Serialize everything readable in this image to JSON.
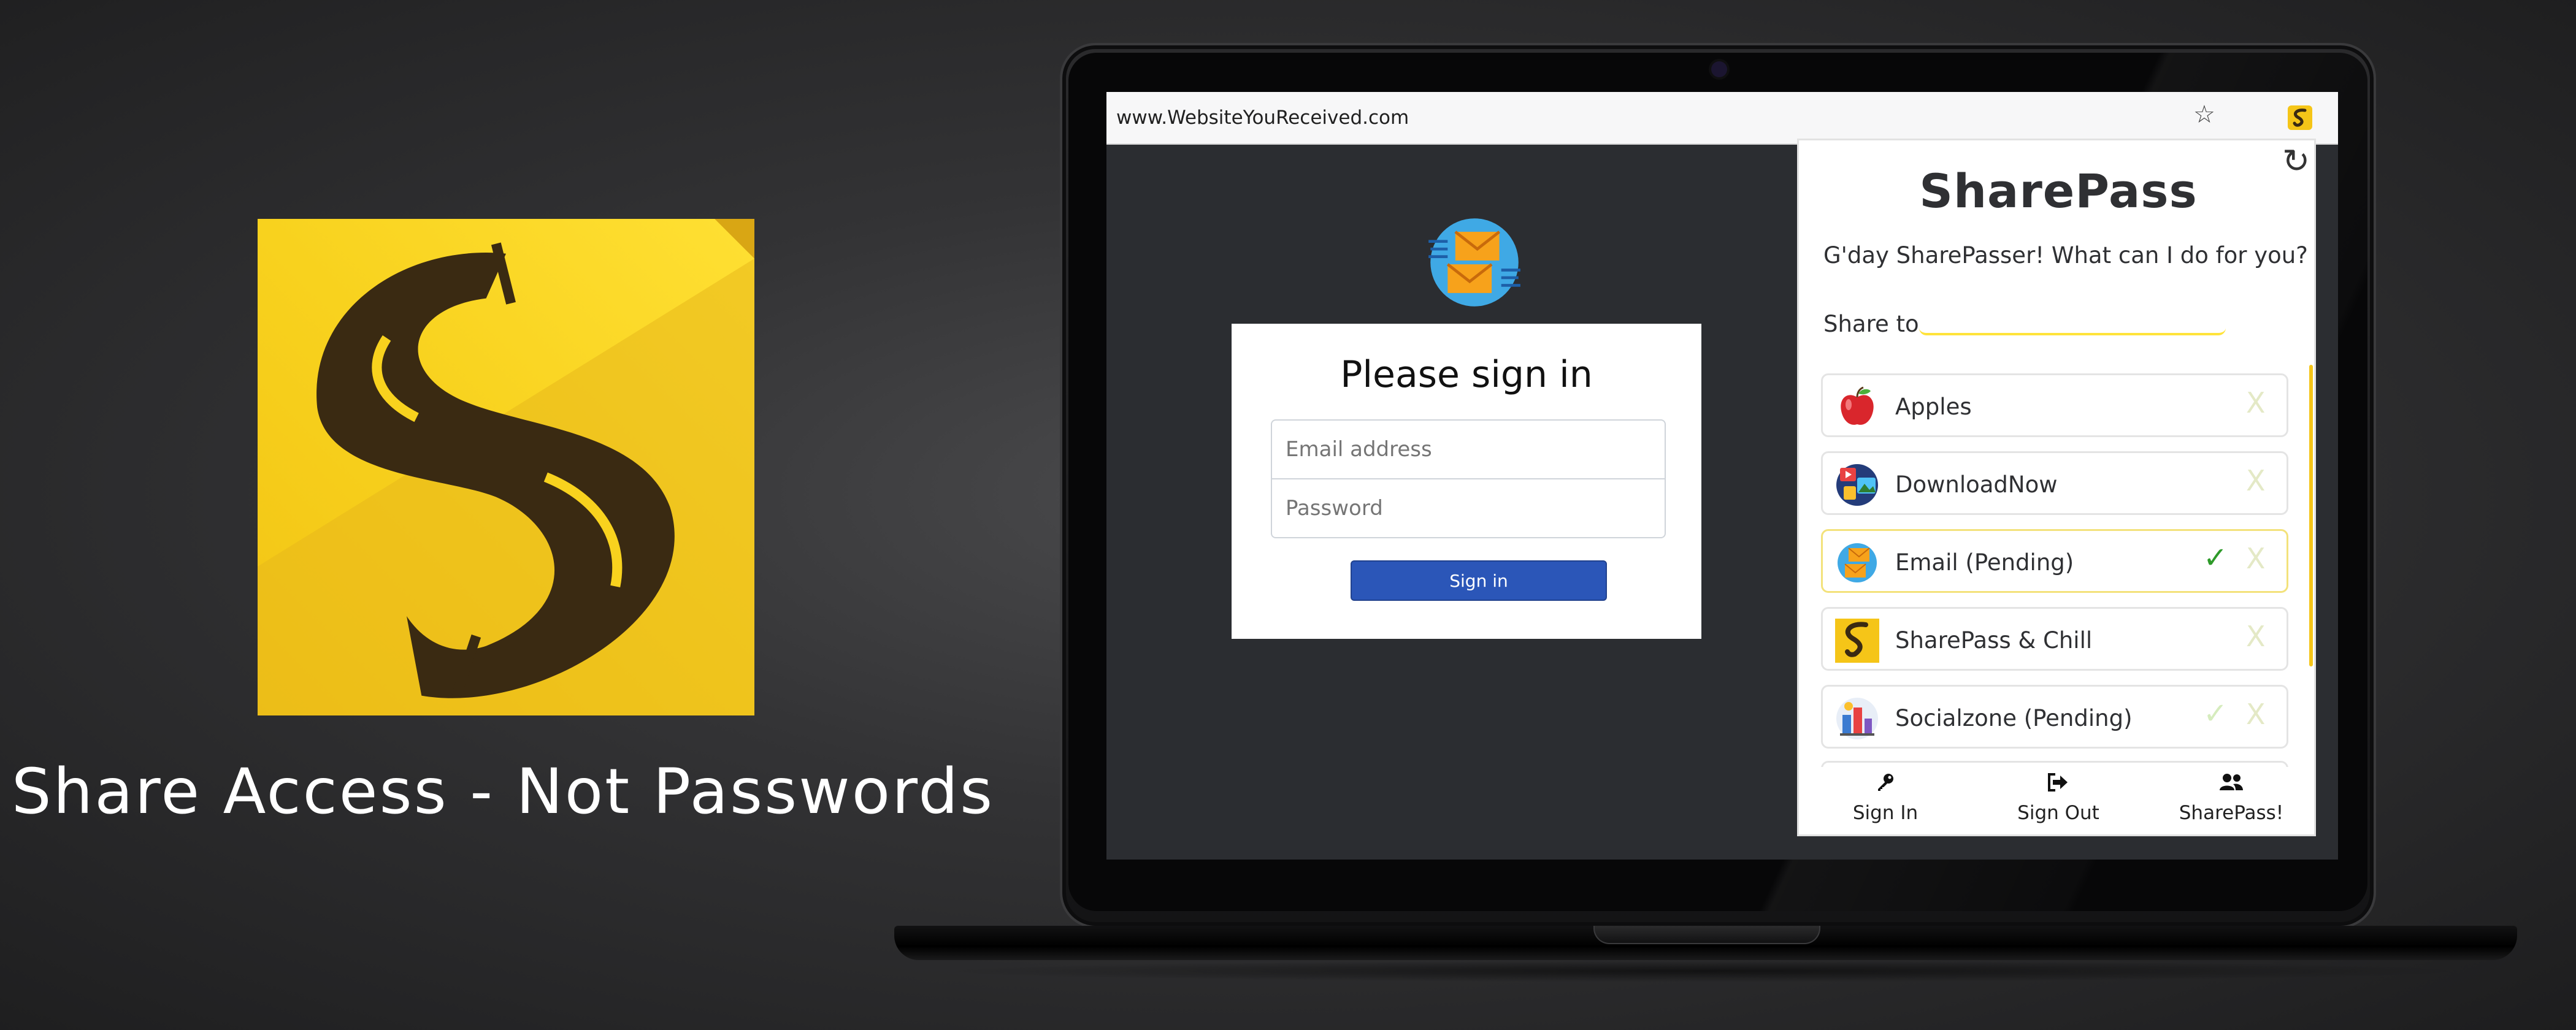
{
  "promo": {
    "tagline": "Share Access - Not Passwords",
    "logo_icon": "sharepass-s-logo"
  },
  "browser": {
    "url": "www.WebsiteYouReceived.com",
    "star_icon": "☆",
    "extension_icon": "sharepass-icon"
  },
  "signin_page": {
    "title": "Please sign in",
    "email_placeholder": "Email address",
    "password_placeholder": "Password",
    "button_label": "Sign in"
  },
  "popup": {
    "refresh_icon": "↻",
    "title": "SharePass",
    "greeting": "G'day SharePasser! What can I do for you?",
    "share_label": "Share to",
    "share_value": "",
    "items": [
      {
        "label": "Apples",
        "icon": "apple-icon",
        "close": "X",
        "check": "",
        "pending": false
      },
      {
        "label": "DownloadNow",
        "icon": "media-icon",
        "close": "X",
        "check": "",
        "pending": false
      },
      {
        "label": "Email (Pending)",
        "icon": "email-icon",
        "close": "X",
        "check": "✓",
        "pending": true
      },
      {
        "label": "SharePass & Chill",
        "icon": "sharepass-icon",
        "close": "X",
        "check": "",
        "pending": false
      },
      {
        "label": "Socialzone (Pending)",
        "icon": "social-icon",
        "close": "X",
        "check": "✓",
        "pending": false
      }
    ],
    "footer": [
      {
        "label": "Sign In",
        "icon": "key-icon"
      },
      {
        "label": "Sign Out",
        "icon": "sign-out-icon"
      },
      {
        "label": "SharePass!",
        "icon": "users-icon"
      }
    ]
  },
  "colors": {
    "brand_yellow": "#f5c518",
    "brand_dark": "#3a2a12",
    "signin_button": "#2b56b8",
    "check_green": "#2e9a2a"
  }
}
